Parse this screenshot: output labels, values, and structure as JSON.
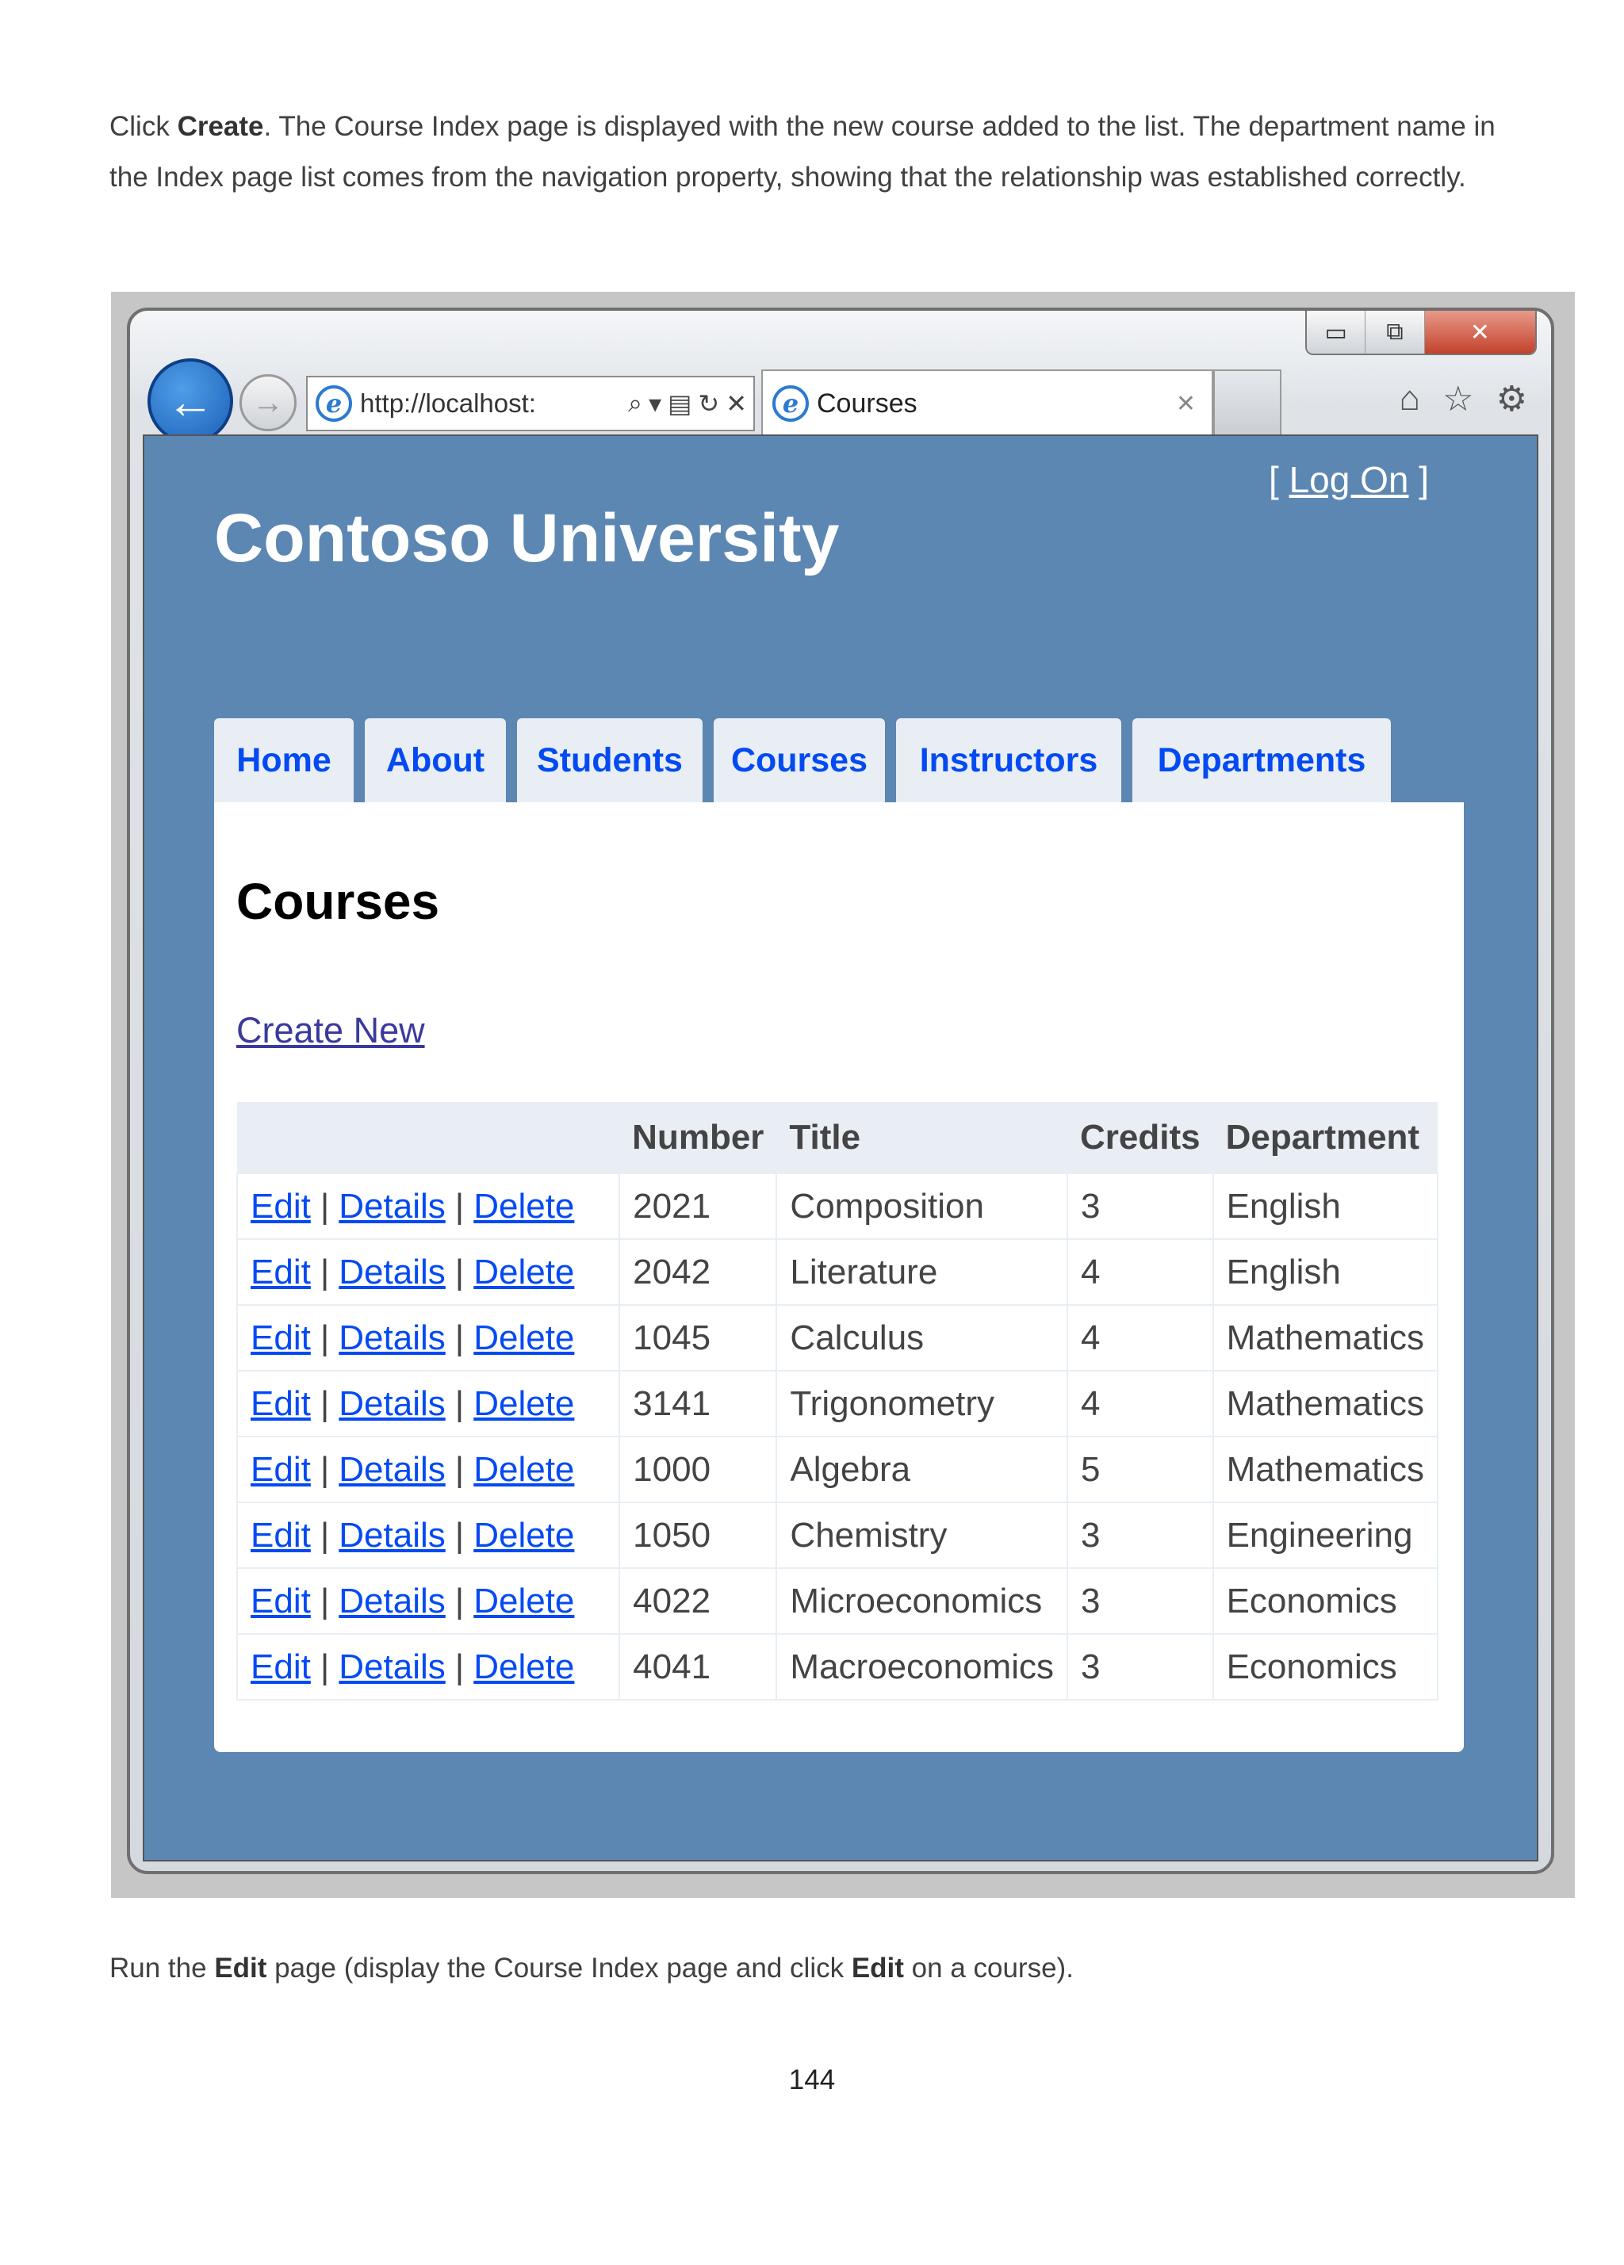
{
  "document": {
    "top_paragraph": {
      "before": "Click ",
      "bold": "Create",
      "after": ". The Course Index page is displayed with the new course added to the list. The department name in the Index page list comes from the navigation property, showing that the relationship was established correctly."
    },
    "bottom_paragraph": {
      "p1": "Run the ",
      "b1": "Edit",
      "p2": " page (display the Course Index page and click ",
      "b2": "Edit",
      "p3": " on a course)."
    },
    "page_number": "144"
  },
  "browser": {
    "address": "http://localhost:",
    "tab_title": "Courses",
    "icons": {
      "back": "back-arrow-icon",
      "forward": "forward-arrow-icon",
      "search": "search-icon",
      "refresh": "refresh-icon",
      "stop": "stop-icon",
      "home": "home-icon",
      "favorites": "star-icon",
      "tools": "gear-icon"
    }
  },
  "site": {
    "logon_open": "[ ",
    "logon_link": "Log On",
    "logon_close": " ]",
    "title": "Contoso University",
    "menu": [
      "Home",
      "About",
      "Students",
      "Courses",
      "Instructors",
      "Departments"
    ]
  },
  "content": {
    "heading": "Courses",
    "create_new": "Create New",
    "columns": [
      "",
      "Number",
      "Title",
      "Credits",
      "Department"
    ],
    "row_actions": [
      "Edit",
      "Details",
      "Delete"
    ],
    "rows": [
      {
        "number": "2021",
        "title": "Composition",
        "credits": "3",
        "department": "English"
      },
      {
        "number": "2042",
        "title": "Literature",
        "credits": "4",
        "department": "English"
      },
      {
        "number": "1045",
        "title": "Calculus",
        "credits": "4",
        "department": "Mathematics"
      },
      {
        "number": "3141",
        "title": "Trigonometry",
        "credits": "4",
        "department": "Mathematics"
      },
      {
        "number": "1000",
        "title": "Algebra",
        "credits": "5",
        "department": "Mathematics"
      },
      {
        "number": "1050",
        "title": "Chemistry",
        "credits": "3",
        "department": "Engineering"
      },
      {
        "number": "4022",
        "title": "Microeconomics",
        "credits": "3",
        "department": "Economics"
      },
      {
        "number": "4041",
        "title": "Macroeconomics",
        "credits": "3",
        "department": "Economics"
      }
    ]
  },
  "colors": {
    "page_background": "#5c87b2",
    "link": "#034af3",
    "menu_background": "#e8eef4"
  }
}
